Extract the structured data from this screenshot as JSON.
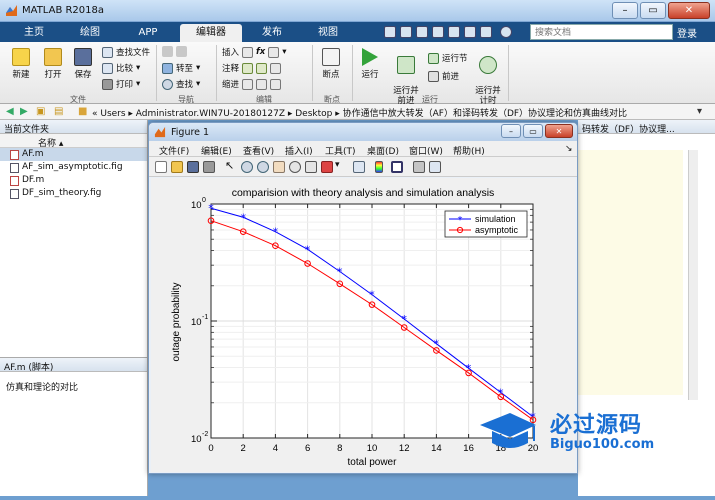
{
  "window": {
    "title": "MATLAB R2018a"
  },
  "tabs": [
    {
      "label": "主页"
    },
    {
      "label": "绘图"
    },
    {
      "label": "APP"
    },
    {
      "label": "编辑器"
    },
    {
      "label": "发布"
    },
    {
      "label": "视图"
    }
  ],
  "search": {
    "placeholder": "搜索文档"
  },
  "login": "登录",
  "ribbon": {
    "file": {
      "new": "新建",
      "open": "打开",
      "save": "保存",
      "find_files": "查找文件",
      "compare": "比较",
      "print": "打印",
      "group": "文件"
    },
    "navigate": {
      "goto": "转至",
      "find": "查找",
      "group": "导航"
    },
    "edit": {
      "insert": "插入",
      "comment": "注释",
      "indent": "缩进",
      "group": "编辑",
      "fx": "fx"
    },
    "breakpoints": {
      "breakpoints": "断点",
      "group": "断点"
    },
    "run": {
      "run": "运行",
      "run_advance": "运行并\n前进",
      "run_section": "运行节",
      "advance": "前进",
      "run_time": "运行并\n计时",
      "group": "运行"
    }
  },
  "address": {
    "path": "« Users ▸ Administrator.WIN7U-20180127Z ▸ Desktop ▸ 协作通信中放大转发（AF）和译码转发（DF）协议理论和仿真曲线对比"
  },
  "current_folder": {
    "title": "当前文件夹",
    "column": "名称 ▴",
    "files": [
      {
        "name": "AF.m",
        "selected": true
      },
      {
        "name": "AF_sim_asymptotic.fig"
      },
      {
        "name": "DF.m"
      },
      {
        "name": "DF_sim_theory.fig"
      }
    ]
  },
  "details": {
    "title": "AF.m  (脚本)",
    "description": "仿真和理论的对比"
  },
  "editor_tab_title": "码转发（DF）协议理...",
  "figure": {
    "title": "Figure 1",
    "menu": [
      "文件(F)",
      "编辑(E)",
      "查看(V)",
      "插入(I)",
      "工具(T)",
      "桌面(D)",
      "窗口(W)",
      "帮助(H)"
    ]
  },
  "chart_data": {
    "type": "line",
    "title": "comparision with theory analysis and simulation analysis",
    "xlabel": "total power",
    "ylabel": "outage probability",
    "xlim": [
      0,
      20
    ],
    "ylim": [
      0.01,
      1
    ],
    "yscale": "log",
    "grid": true,
    "legend_position": "top-right",
    "x": [
      0,
      2,
      4,
      6,
      8,
      10,
      12,
      14,
      16,
      18,
      20
    ],
    "xticks": [
      "0",
      "2",
      "4",
      "6",
      "8",
      "10",
      "12",
      "14",
      "16",
      "18",
      "20"
    ],
    "yticks": [
      {
        "value": 1,
        "label": "10",
        "exp": "0"
      },
      {
        "value": 0.1,
        "label": "10",
        "exp": "-1"
      },
      {
        "value": 0.01,
        "label": "10",
        "exp": "-2"
      }
    ],
    "series": [
      {
        "name": "simulation",
        "color": "#0000ff",
        "marker": "*",
        "values": [
          0.92,
          0.77,
          0.58,
          0.41,
          0.265,
          0.168,
          0.104,
          0.064,
          0.0395,
          0.0245,
          0.0152
        ]
      },
      {
        "name": "asymptotic",
        "color": "#ff0000",
        "marker": "o",
        "values": [
          0.72,
          0.58,
          0.44,
          0.31,
          0.208,
          0.138,
          0.088,
          0.056,
          0.036,
          0.0225,
          0.0143
        ]
      }
    ]
  },
  "watermark": {
    "text": "必过源码",
    "url": "Biguo100.com"
  }
}
